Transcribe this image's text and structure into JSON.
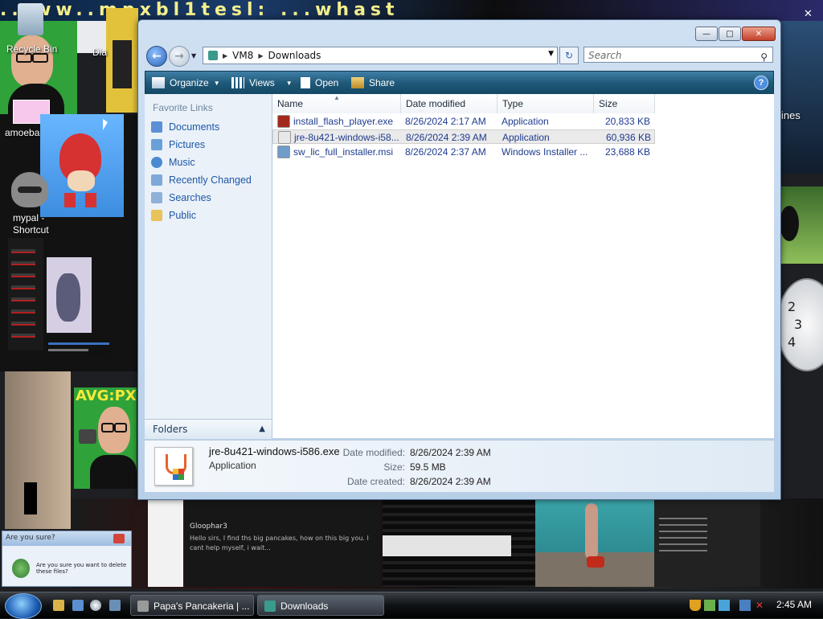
{
  "desktop": {
    "banner_text": "...ww..mpxbl1tesl: ...whast",
    "icons": [
      {
        "label": "Recycle Bin"
      },
      {
        "label": "amoeba.JPG"
      },
      {
        "label": "mypal - Shortcut"
      }
    ],
    "partial_label_top": "Dia",
    "right_gadget_text": "ines",
    "clock_gadget_numbers": [
      "2",
      "3",
      "4"
    ],
    "tile_text_avgpx": "AVG:PX",
    "dialog_title": "Are you sure?",
    "dialog_text": "Are you sure you want to delete these files?",
    "chat_snippet_1": "Gloophar3",
    "chat_snippet_2": "Hello sirs, I find ths big pancakes, how on this big you. I cant help myself, i wait..."
  },
  "window": {
    "address": {
      "root": "VM8",
      "folder": "Downloads"
    },
    "search_placeholder": "Search",
    "toolbar": {
      "organize": "Organize",
      "views": "Views",
      "open": "Open",
      "share": "Share"
    },
    "favorites_title": "Favorite Links",
    "favorites": [
      {
        "label": "Documents",
        "color": "#5b8fd6"
      },
      {
        "label": "Pictures",
        "color": "#6aa0d8"
      },
      {
        "label": "Music",
        "color": "#4b8ad0"
      },
      {
        "label": "Recently Changed",
        "color": "#7ea8d8"
      },
      {
        "label": "Searches",
        "color": "#8fb0d8"
      },
      {
        "label": "Public",
        "color": "#e8c25a"
      }
    ],
    "folders_label": "Folders",
    "columns": {
      "name": "Name",
      "date": "Date modified",
      "type": "Type",
      "size": "Size"
    },
    "files": [
      {
        "name": "install_flash_player.exe",
        "date": "8/26/2024 2:17 AM",
        "type": "Application",
        "size": "20,833 KB",
        "icon": "flash-icon",
        "color": "#a3281c"
      },
      {
        "name": "jre-8u421-windows-i58...",
        "date": "8/26/2024 2:39 AM",
        "type": "Application",
        "size": "60,936 KB",
        "icon": "java-icon",
        "color": "#e8e8e8"
      },
      {
        "name": "sw_lic_full_installer.msi",
        "date": "8/26/2024 2:37 AM",
        "type": "Windows Installer ...",
        "size": "23,688 KB",
        "icon": "installer-icon",
        "color": "#6f9cc8"
      }
    ],
    "details": {
      "name": "jre-8u421-windows-i586.exe",
      "type": "Application",
      "modified_label": "Date modified:",
      "modified": "8/26/2024 2:39 AM",
      "size_label": "Size:",
      "size": "59.5 MB",
      "created_label": "Date created:",
      "created": "8/26/2024 2:39 AM"
    }
  },
  "taskbar": {
    "tasks": [
      {
        "label": "Papa's Pancakeria | ...",
        "active": false
      },
      {
        "label": "Downloads",
        "active": true
      }
    ],
    "clock": "2:45 AM"
  }
}
